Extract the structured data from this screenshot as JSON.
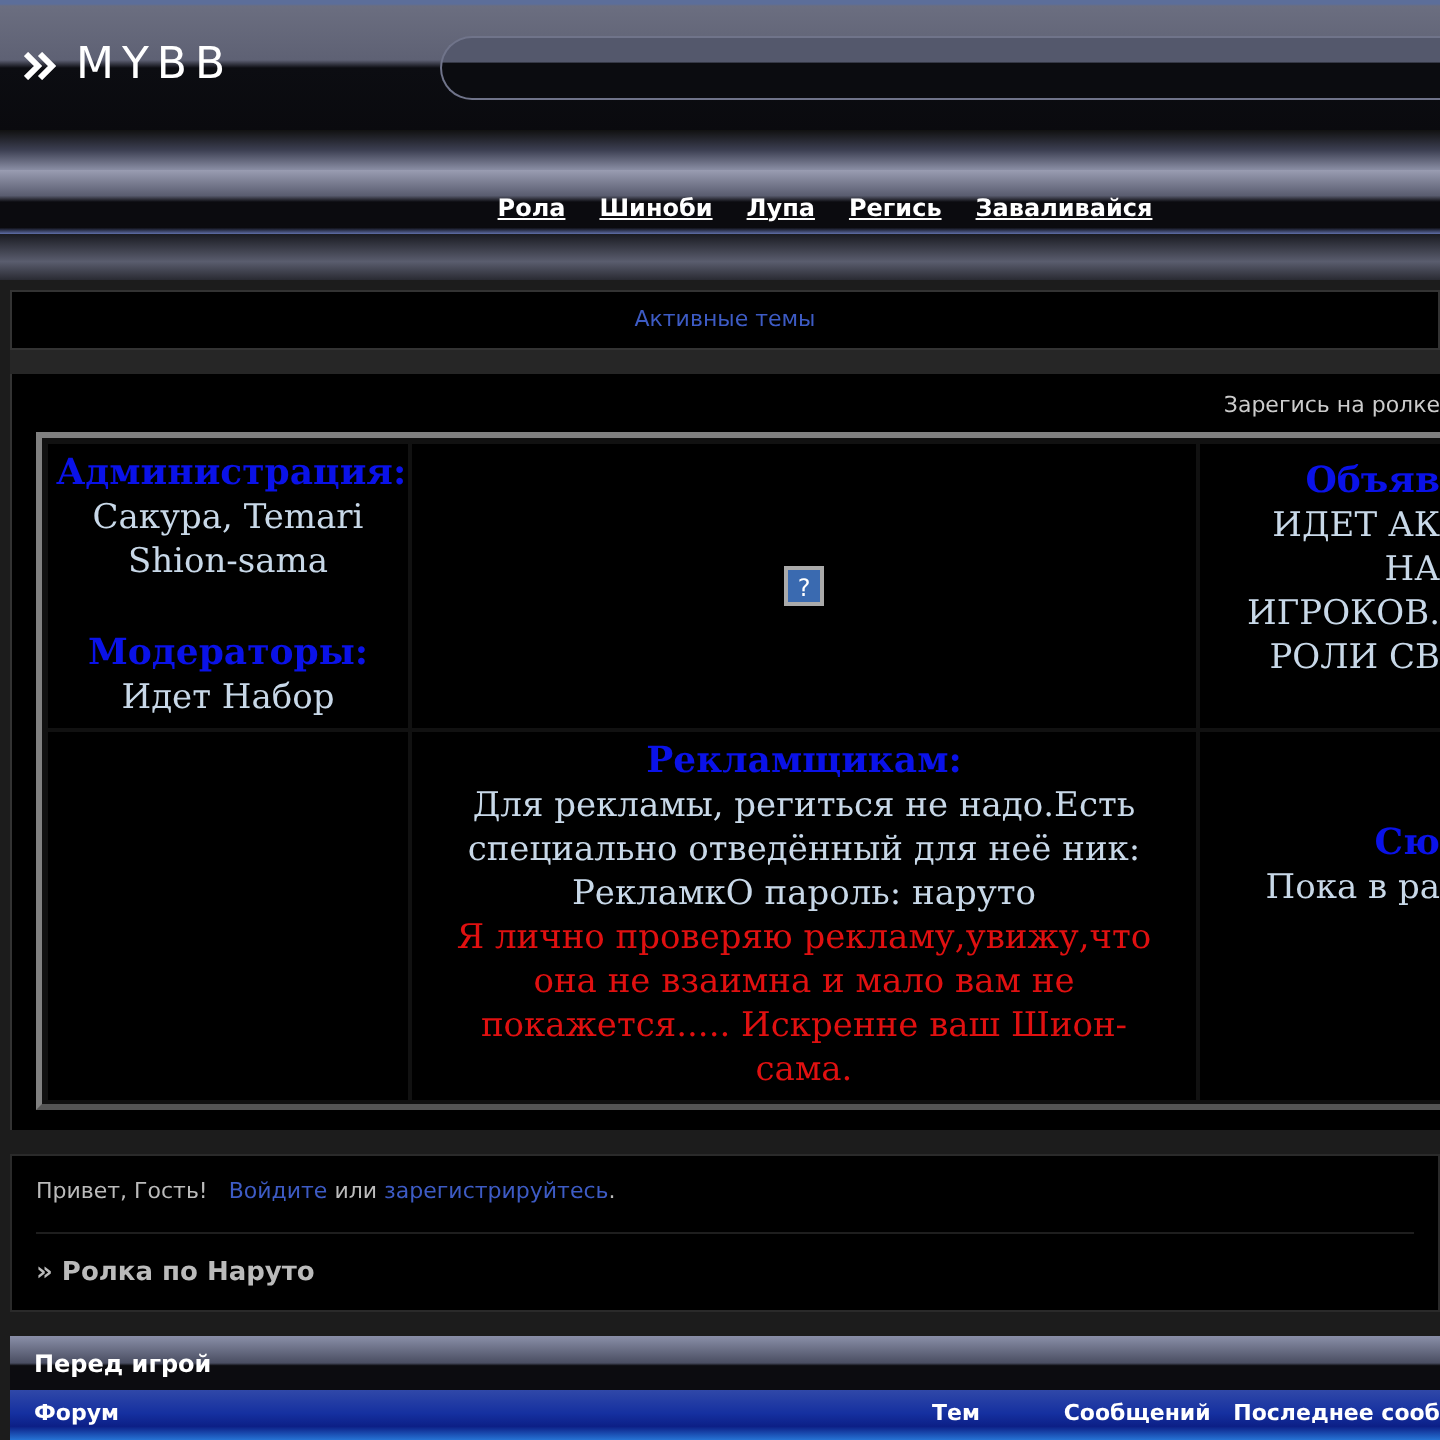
{
  "header": {
    "logo": "MYBB",
    "nav": [
      "Рола",
      "Шиноби",
      "Лупа",
      "Регись",
      "Заваливайся"
    ]
  },
  "active_topics": "Активные темы",
  "announce_bar": "Зарегись на ролке",
  "info_table": {
    "admin_title": "Администрация:",
    "admins": [
      "Сакура, Temari",
      "Shion-sama"
    ],
    "mod_title": "Модераторы:",
    "mods": "Идет Набор",
    "ads_title": "Рекламщикам:",
    "ads_text": "Для рекламы, региться не надо.Есть специально отведённый для неё ник: РекламкО пароль: наруто",
    "ads_warning": "Я лично проверяю рекламу,увижу,что она не взаимна и мало вам не покажется..... Искренне ваш Шион-сама.",
    "image_glyph": "?",
    "right_top_title": "Объяв",
    "right_top_lines": [
      "ИДЕТ АК",
      "НА",
      "ИГРОКОВ.",
      "РОЛИ СВ"
    ],
    "right_bottom_title": "Сю",
    "right_bottom_text": "Пока в ра"
  },
  "welcome": {
    "greeting": "Привет, Гость!",
    "login_link": "Войдите",
    "or": "или",
    "register_link": "зарегистрируйтесь",
    "period": "."
  },
  "breadcrumb": "» Ролка по Наруто",
  "category": {
    "title": "Перед игрой",
    "columns": [
      "Форум",
      "Тем",
      "Сообщений",
      "Последнее сооб"
    ]
  }
}
